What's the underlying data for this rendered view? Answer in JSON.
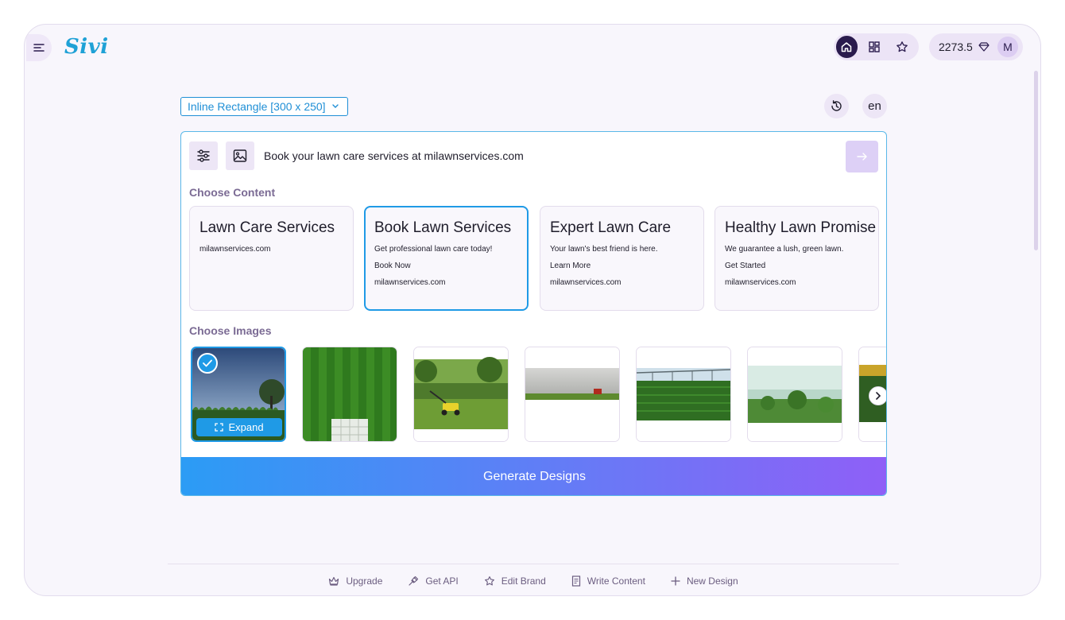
{
  "app": {
    "logo": "Sivi"
  },
  "header": {
    "credits": "2273.5",
    "avatar_initial": "M",
    "nav": [
      "home-icon",
      "grid-icon",
      "star-icon"
    ]
  },
  "format": {
    "selected": "Inline Rectangle [300 x 250]"
  },
  "language": "en",
  "prompt": {
    "value": "Book your lawn care services at milawnservices.com"
  },
  "content": {
    "title": "Choose Content",
    "cards": [
      {
        "title": "Lawn Care Services",
        "lines": [
          "milawnservices.com"
        ],
        "selected": false
      },
      {
        "title": "Book Lawn Services",
        "lines": [
          "Get professional lawn care today!",
          "Book Now",
          "milawnservices.com"
        ],
        "selected": true
      },
      {
        "title": "Expert Lawn Care",
        "lines": [
          "Your lawn's best friend is here.",
          "Learn More",
          "milawnservices.com"
        ],
        "selected": false
      },
      {
        "title": "Healthy Lawn Promise",
        "lines": [
          "We guarantee a lush, green lawn.",
          "Get Started",
          "milawnservices.com"
        ],
        "selected": false
      }
    ]
  },
  "images": {
    "title": "Choose Images",
    "expand_label": "Expand"
  },
  "generate_label": "Generate Designs",
  "footer": {
    "items": [
      {
        "label": "Upgrade",
        "icon": "crown-icon"
      },
      {
        "label": "Get API",
        "icon": "plug-icon"
      },
      {
        "label": "Edit Brand",
        "icon": "star-icon"
      },
      {
        "label": "Write Content",
        "icon": "document-icon"
      },
      {
        "label": "New Design",
        "icon": "plus-icon"
      }
    ]
  },
  "colors": {
    "accent": "#1f9ae6",
    "brand": "#1fa1d6",
    "gradient_start": "#2b9cf5",
    "gradient_end": "#8f5ff7"
  }
}
